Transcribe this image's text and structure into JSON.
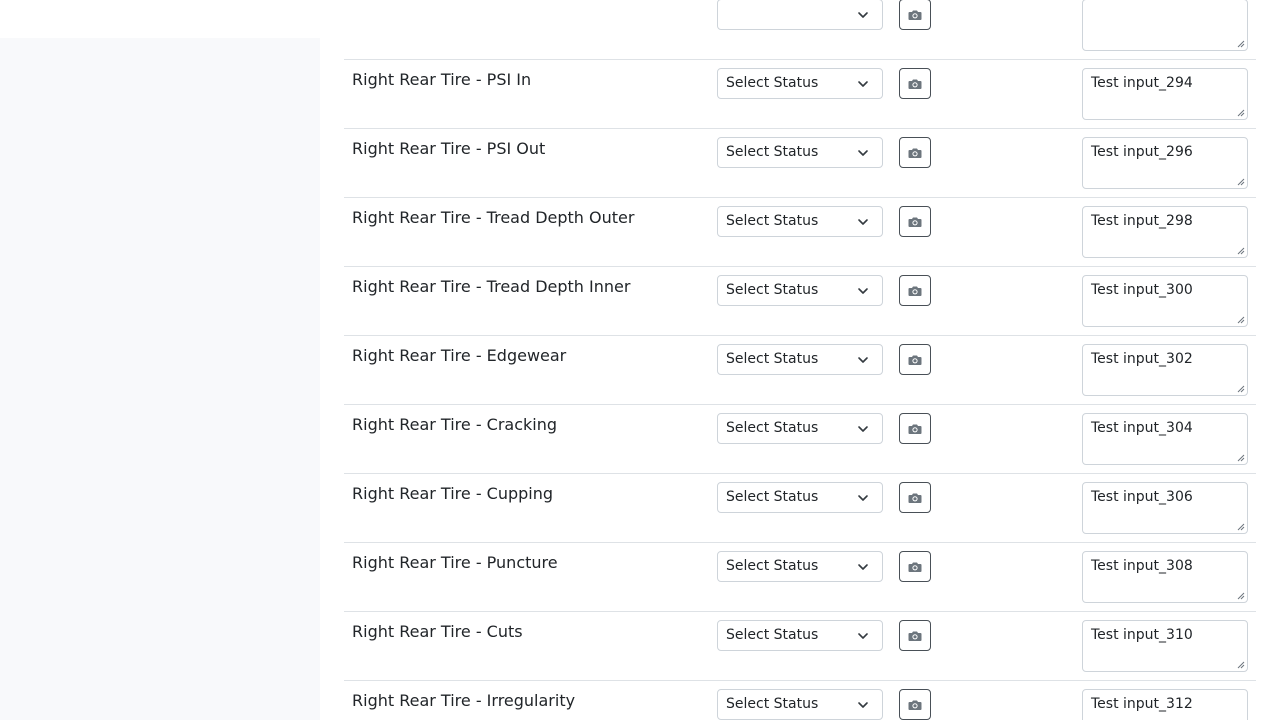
{
  "rows": [
    {
      "label": "",
      "status": "",
      "note": ""
    },
    {
      "label": "Right Rear Tire - PSI In",
      "status": "Select Status",
      "note": "Test input_294"
    },
    {
      "label": "Right Rear Tire - PSI Out",
      "status": "Select Status",
      "note": "Test input_296"
    },
    {
      "label": "Right Rear Tire - Tread Depth Outer",
      "status": "Select Status",
      "note": "Test input_298"
    },
    {
      "label": "Right Rear Tire - Tread Depth Inner",
      "status": "Select Status",
      "note": "Test input_300"
    },
    {
      "label": "Right Rear Tire - Edgewear",
      "status": "Select Status",
      "note": "Test input_302"
    },
    {
      "label": "Right Rear Tire - Cracking",
      "status": "Select Status",
      "note": "Test input_304"
    },
    {
      "label": "Right Rear Tire - Cupping",
      "status": "Select Status",
      "note": "Test input_306"
    },
    {
      "label": "Right Rear Tire - Puncture",
      "status": "Select Status",
      "note": "Test input_308"
    },
    {
      "label": "Right Rear Tire - Cuts",
      "status": "Select Status",
      "note": "Test input_310"
    },
    {
      "label": "Right Rear Tire - Irregularity",
      "status": "Select Status",
      "note": "Test input_312"
    }
  ],
  "icons": {
    "camera": "camera-icon",
    "dropdown": "chevron-down-icon",
    "resize": "resize-grip-icon"
  },
  "colors": {
    "sidebar_bg": "#f8f9fb",
    "border": "#dee2e6",
    "button_border": "#495057"
  }
}
